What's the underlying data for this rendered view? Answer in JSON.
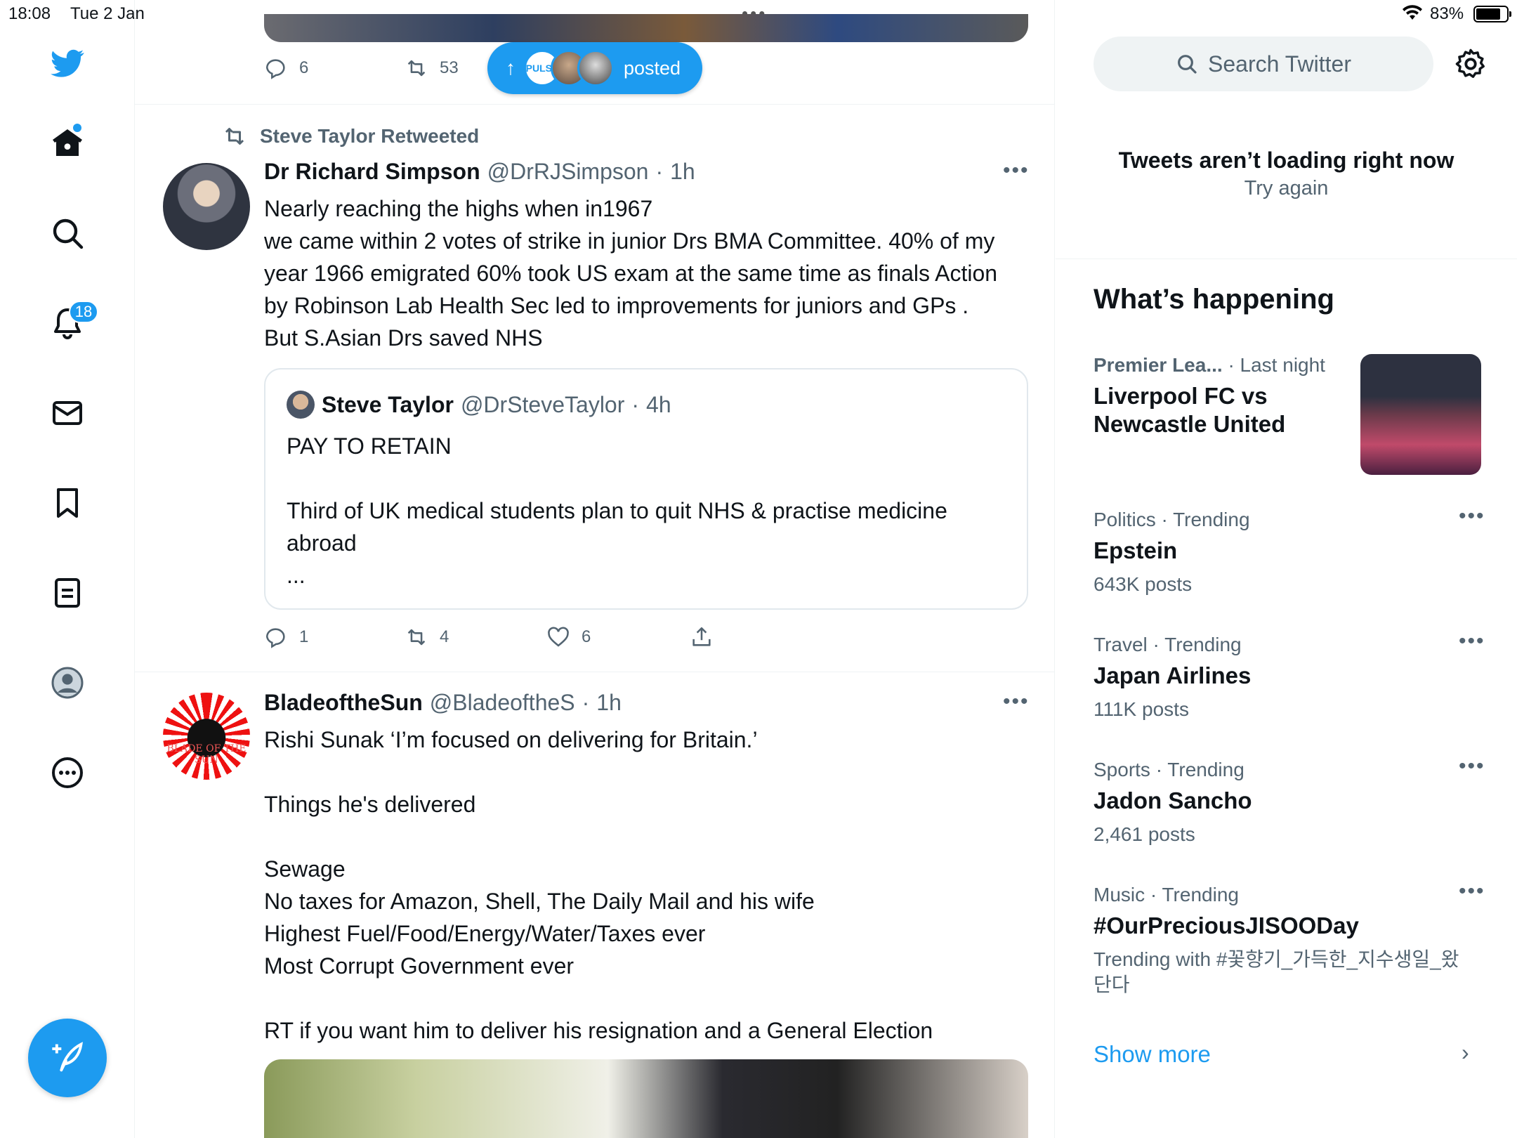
{
  "status_bar": {
    "time": "18:08",
    "date": "Tue 2 Jan",
    "battery": "83%"
  },
  "nav": {
    "notifications_badge": "18"
  },
  "top_tweet_actions": {
    "replies": "6",
    "retweets": "53"
  },
  "new_posts_pill": {
    "label": "posted",
    "avatar1_text": "PULSE"
  },
  "tweet1": {
    "retweeted_by": "Steve Taylor Retweeted",
    "name": "Dr Richard Simpson",
    "handle": "@DrRJSimpson",
    "sep": "·",
    "time": "1h",
    "text": "Nearly reaching the highs when in1967\nwe came within 2 votes of strike in junior Drs BMA Committee. 40% of my year 1966 emigrated 60% took US exam at the same time as finals Action by Robinson Lab Health Sec led to improvements for juniors and GPs . But S.Asian Drs saved NHS",
    "quote": {
      "name": "Steve Taylor",
      "handle": "@DrSteveTaylor",
      "sep": "·",
      "time": "4h",
      "text": "PAY TO RETAIN\n\nThird of UK medical students plan to quit NHS & practise medicine abroad\n..."
    },
    "replies": "1",
    "retweets": "4",
    "likes": "6"
  },
  "tweet2": {
    "name": "BladeoftheSun",
    "handle": "@BladeoftheS",
    "sep": "·",
    "time": "1h",
    "avatar_text": "BLADE OF THE SUN",
    "text": "Rishi Sunak ‘I’m focused on delivering for Britain.’\n\nThings he's delivered\n\nSewage\nNo taxes for Amazon, Shell, The Daily Mail and his wife\nHighest Fuel/Food/Energy/Water/Taxes ever\nMost Corrupt Government ever\n\nRT if you want him to deliver his resignation and a General Election"
  },
  "sidebar": {
    "search_placeholder": "Search Twitter",
    "error_title": "Tweets aren’t loading right now",
    "error_retry": "Try again",
    "whats_happening": "What’s happening",
    "trends": [
      {
        "category": "Premier Lea...",
        "extra": "· Last night",
        "title": "Liverpool FC vs Newcastle United",
        "count": ""
      },
      {
        "category": "Politics · Trending",
        "extra": "",
        "title": "Epstein",
        "count": "643K posts"
      },
      {
        "category": "Travel · Trending",
        "extra": "",
        "title": "Japan Airlines",
        "count": "111K posts"
      },
      {
        "category": "Sports · Trending",
        "extra": "",
        "title": "Jadon Sancho",
        "count": "2,461 posts"
      },
      {
        "category": "Music · Trending",
        "extra": "",
        "title": "#OurPreciousJISOODay",
        "count": "Trending with #꽃향기_가득한_지수생일_왔단다"
      }
    ],
    "show_more": "Show more"
  }
}
